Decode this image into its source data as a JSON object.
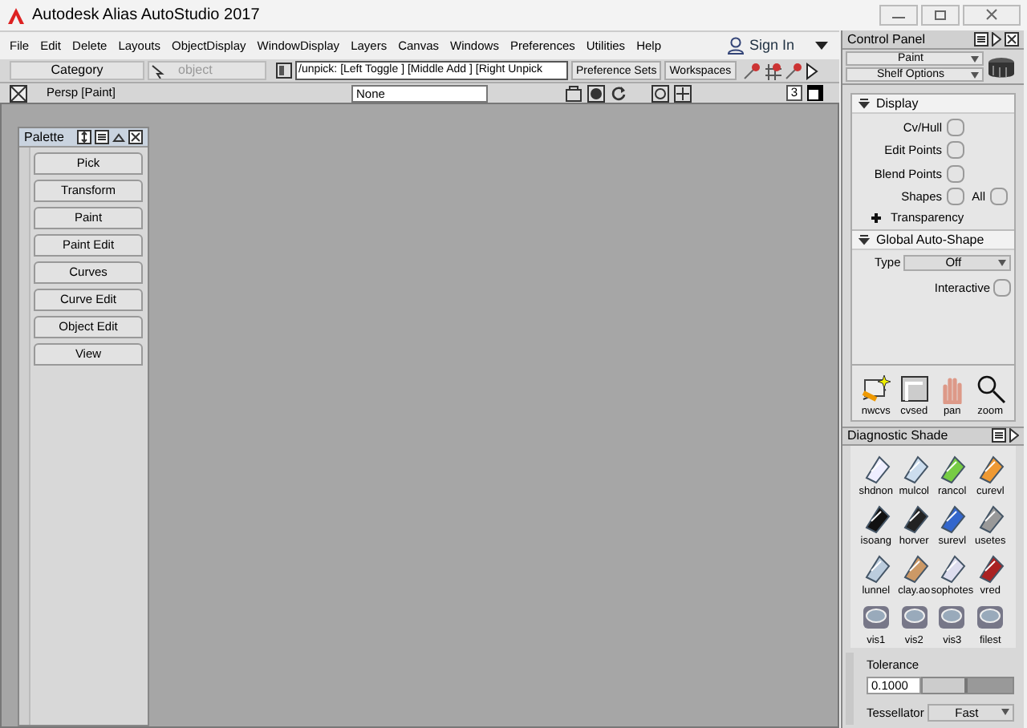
{
  "window": {
    "title": "Autodesk Alias AutoStudio 2017"
  },
  "menu": [
    "File",
    "Edit",
    "Delete",
    "Layouts",
    "ObjectDisplay",
    "WindowDisplay",
    "Layers",
    "Canvas",
    "Windows",
    "Preferences",
    "Utilities",
    "Help"
  ],
  "sign_in": "Sign In",
  "toolbar": {
    "category": "Category",
    "object": "object",
    "prompt": "/unpick: [Left Toggle ] [Middle Add ] [Right Unpick",
    "tabs": [
      "Preference Sets",
      "Workspaces"
    ]
  },
  "viewport": {
    "title": "Persp [Paint]",
    "field": "None",
    "counter": "3"
  },
  "palette": {
    "title": "Palette",
    "items": [
      "Pick",
      "Transform",
      "Paint",
      "Paint Edit",
      "Curves",
      "Curve Edit",
      "Object Edit",
      "View"
    ]
  },
  "control_panel": {
    "title": "Control Panel",
    "dropdowns": [
      "Paint",
      "Shelf Options"
    ],
    "display": {
      "title": "Display",
      "options": [
        {
          "label": "Cv/Hull",
          "checked": false
        },
        {
          "label": "Edit Points",
          "checked": false
        },
        {
          "label": "Blend Points",
          "checked": false
        },
        {
          "label": "Shapes",
          "checked": false
        },
        {
          "label": "All",
          "checked": false
        }
      ],
      "transparency": {
        "label": "Transparency",
        "expanded": false
      }
    },
    "auto_shape": {
      "title": "Global Auto-Shape",
      "type_label": "Type",
      "type_value": "Off",
      "interactive": {
        "label": "Interactive",
        "checked": false
      }
    },
    "tools": [
      "nwcvs",
      "cvsed",
      "pan",
      "zoom"
    ]
  },
  "diagnostic_shade": {
    "title": "Diagnostic Shade",
    "items": [
      "shdnon",
      "mulcol",
      "rancol",
      "curevl",
      "isoang",
      "horver",
      "surevl",
      "usetes",
      "lunnel",
      "clay.ao",
      "sophotes",
      "vred",
      "vis1",
      "vis2",
      "vis3",
      "filest"
    ],
    "tolerance": {
      "label": "Tolerance",
      "value": "0.1000",
      "level": 0.5
    },
    "tessellator": {
      "label": "Tessellator",
      "value": "Fast"
    }
  }
}
